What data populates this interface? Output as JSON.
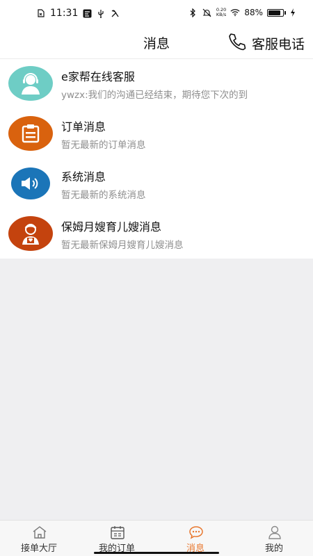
{
  "status_bar": {
    "time": "11:31",
    "speed_top": "0.20",
    "speed_bottom": "KB/s",
    "battery_percent": 88,
    "battery_text": "88%"
  },
  "header": {
    "title": "消息",
    "service_label": "客服电话"
  },
  "messages": [
    {
      "title": "e家帮在线客服",
      "subtitle": "ywzx:我们的沟通已经结束，期待您下次的到",
      "avatar_icon": "customer-service-icon",
      "color": "#6ecdc5"
    },
    {
      "title": "订单消息",
      "subtitle": "暂无最新的订单消息",
      "avatar_icon": "order-clipboard-icon",
      "color": "#d9620e"
    },
    {
      "title": "系统消息",
      "subtitle": "暂无最新的系统消息",
      "avatar_icon": "speaker-icon",
      "color": "#1b75b8"
    },
    {
      "title": "保姆月嫂育儿嫂消息",
      "subtitle": "暂无最新保姆月嫂育儿嫂消息",
      "avatar_icon": "nanny-icon",
      "color": "#c4430e"
    }
  ],
  "tabs": [
    {
      "label": "接单大厅",
      "icon": "home-icon",
      "active": false
    },
    {
      "label": "我的订单",
      "icon": "calendar-icon",
      "active": false
    },
    {
      "label": "消息",
      "icon": "chat-bubble-icon",
      "active": true
    },
    {
      "label": "我的",
      "icon": "user-icon",
      "active": false
    }
  ],
  "colors": {
    "accent": "#e8772e",
    "background": "#efeff1",
    "subtitle": "#8e8e8e"
  }
}
